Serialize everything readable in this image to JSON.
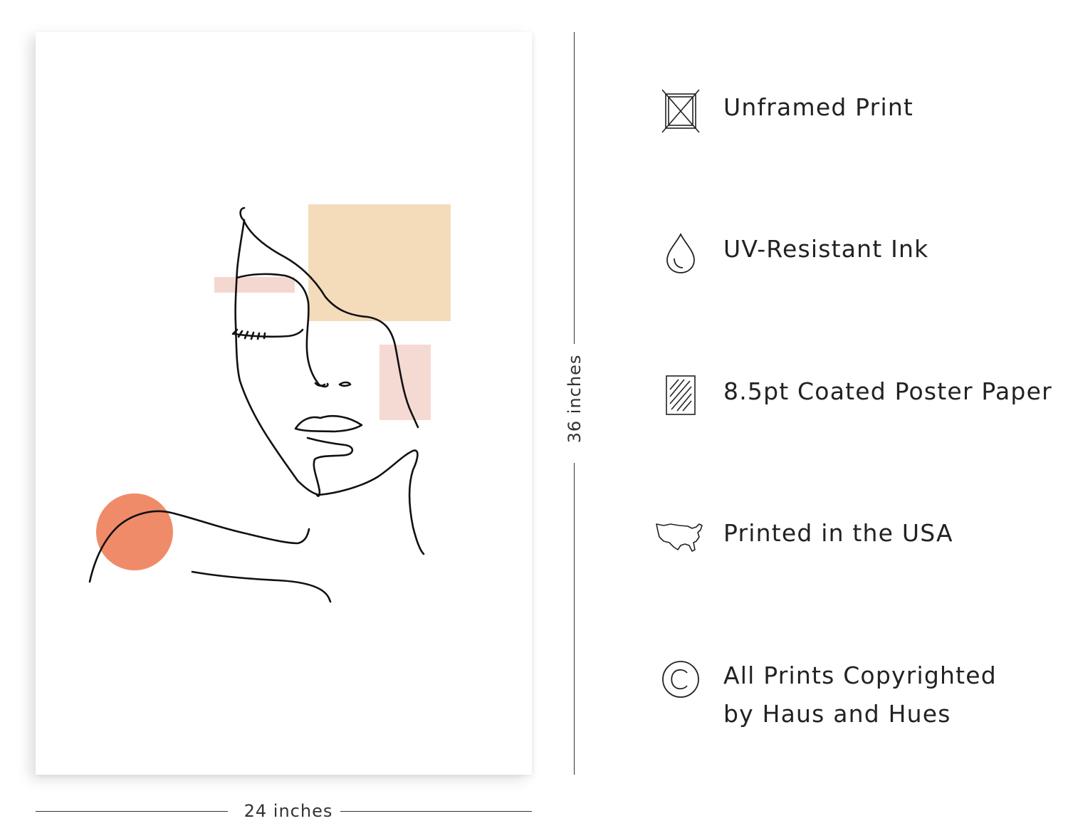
{
  "dimensions": {
    "height_label": "36 inches",
    "width_label": "24 inches"
  },
  "artwork": {
    "colors": {
      "large_square": "#f4dcbb",
      "small_bar": "#f4d8d0",
      "small_square": "#f4dad2",
      "circle": "#f08b69",
      "line": "#111111"
    }
  },
  "features": [
    {
      "icon": "unframed-frame-icon",
      "label": "Unframed Print"
    },
    {
      "icon": "ink-drop-icon",
      "label": "UV-Resistant Ink"
    },
    {
      "icon": "paper-sheet-icon",
      "label": "8.5pt Coated Poster Paper"
    },
    {
      "icon": "usa-map-icon",
      "label": "Printed in the USA"
    },
    {
      "icon": "copyright-icon",
      "label_line1": "All Prints Copyrighted",
      "label_line2": "by Haus and Hues"
    }
  ]
}
